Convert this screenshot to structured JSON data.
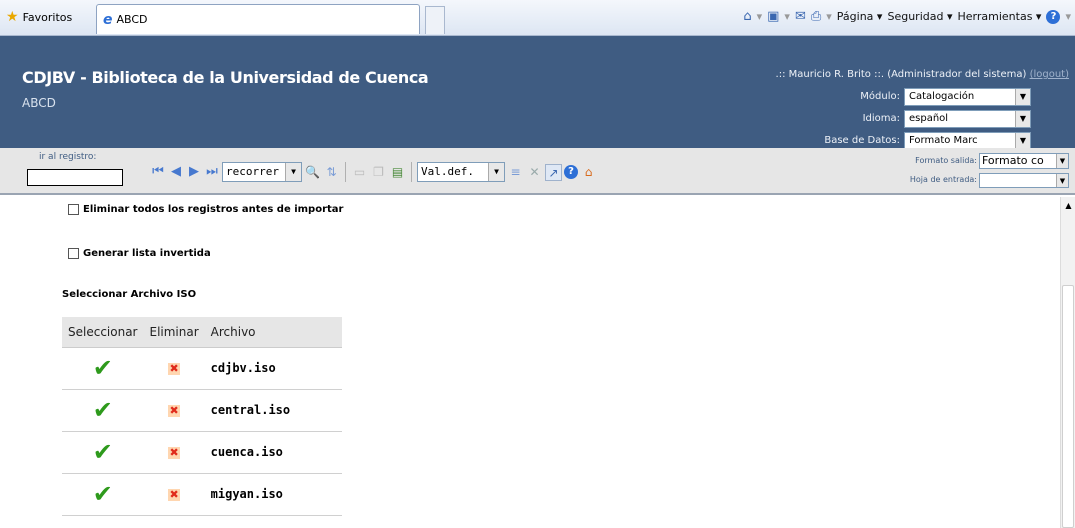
{
  "browser": {
    "favorites_label": "Favoritos",
    "tab_title": "ABCD",
    "menu": {
      "page": "Página",
      "security": "Seguridad",
      "tools": "Herramientas"
    }
  },
  "header": {
    "title": "CDJBV - Biblioteca de la Universidad de Cuenca",
    "subtitle": "ABCD",
    "user": ".:: Mauricio R. Brito ::. (Administrador del sistema)",
    "logout": "(logout)",
    "module_label": "Módulo:",
    "module_value": "Catalogación",
    "language_label": "Idioma:",
    "language_value": "español",
    "database_label": "Base de Datos:",
    "database_value": "Formato Marc"
  },
  "toolbar": {
    "goto_label": "ir al registro:",
    "goto_value": "",
    "browse_value": "recorrer",
    "defaults_value": "Val.def.",
    "output_format_label": "Formato salida:",
    "output_format_value": "Formato co",
    "entry_sheet_label": "Hoja de entrada:",
    "entry_sheet_value": ""
  },
  "content": {
    "delete_all_label": "Eliminar todos los registros antes de importar",
    "delete_all_checked": false,
    "inverted_list_label": "Generar lista invertida",
    "inverted_list_checked": false,
    "section_title": "Seleccionar Archivo ISO",
    "table": {
      "headers": [
        "Seleccionar",
        "Eliminar",
        "Archivo"
      ],
      "rows": [
        {
          "file": "cdjbv.iso"
        },
        {
          "file": "central.iso"
        },
        {
          "file": "cuenca.iso"
        },
        {
          "file": "migyan.iso"
        }
      ]
    }
  }
}
